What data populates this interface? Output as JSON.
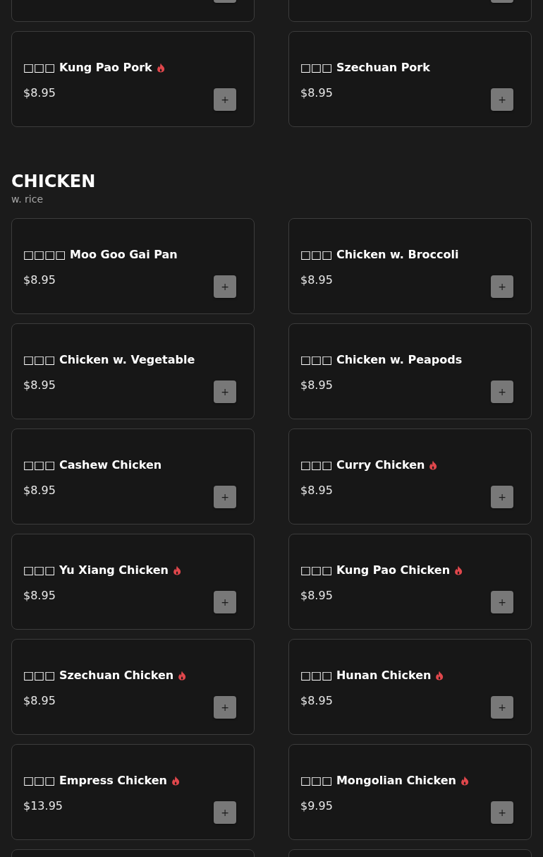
{
  "previous_items": [
    {
      "name": "□□□ Kung Pao Pork",
      "price": "$8.95",
      "spicy": true,
      "button": "+"
    },
    {
      "name": "□□□ Szechuan Pork",
      "price": "$8.95",
      "spicy": false,
      "button": "+"
    }
  ],
  "sections": [
    {
      "title": "CHICKEN",
      "note": "w. rice",
      "items": [
        {
          "name": "□□□□ Moo Goo Gai Pan",
          "price": "$8.95",
          "spicy": false,
          "button": "+"
        },
        {
          "name": "□□□ Chicken w. Broccoli",
          "price": "$8.95",
          "spicy": false,
          "button": "+"
        },
        {
          "name": "□□□ Chicken w. Vegetable",
          "price": "$8.95",
          "spicy": false,
          "button": "+"
        },
        {
          "name": "□□□ Chicken w. Peapods",
          "price": "$8.95",
          "spicy": false,
          "button": "+"
        },
        {
          "name": "□□□ Cashew Chicken",
          "price": "$8.95",
          "spicy": false,
          "button": "+"
        },
        {
          "name": "□□□ Curry Chicken",
          "price": "$8.95",
          "spicy": true,
          "button": "+"
        },
        {
          "name": "□□□ Yu Xiang Chicken",
          "price": "$8.95",
          "spicy": true,
          "button": "+"
        },
        {
          "name": "□□□ Kung Pao Chicken",
          "price": "$8.95",
          "spicy": true,
          "button": "+"
        },
        {
          "name": "□□□ Szechuan Chicken",
          "price": "$8.95",
          "spicy": true,
          "button": "+"
        },
        {
          "name": "□□□ Hunan Chicken",
          "price": "$8.95",
          "spicy": true,
          "button": "+"
        },
        {
          "name": "□□□ Empress Chicken",
          "price": "$13.95",
          "spicy": true,
          "button": "+"
        },
        {
          "name": "□□□ Mongolian Chicken",
          "price": "$9.95",
          "spicy": true,
          "button": "+"
        }
      ]
    }
  ]
}
